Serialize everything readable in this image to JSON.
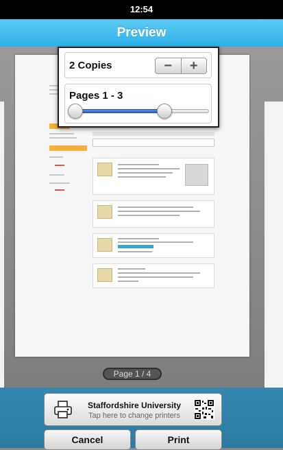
{
  "status_bar": {
    "time": "12:54"
  },
  "nav": {
    "title": "Preview"
  },
  "print_options": {
    "copies_label": "2 Copies",
    "copies_value": 2,
    "minus_symbol": "−",
    "plus_symbol": "+",
    "pages_label": "Pages 1 - 3",
    "page_range": {
      "from": 1,
      "to": 3,
      "total": 4
    }
  },
  "page_indicator": "Page 1 / 4",
  "printer": {
    "name": "Staffordshire University",
    "hint": "Tap here to change printers",
    "icon": "printer-icon",
    "qr_icon": "qr-code-icon"
  },
  "buttons": {
    "cancel": "Cancel",
    "print": "Print"
  },
  "colors": {
    "nav_bar": "#34b6ec",
    "slider_fill": "#3b6fd6",
    "footer": "#2f82aa"
  }
}
